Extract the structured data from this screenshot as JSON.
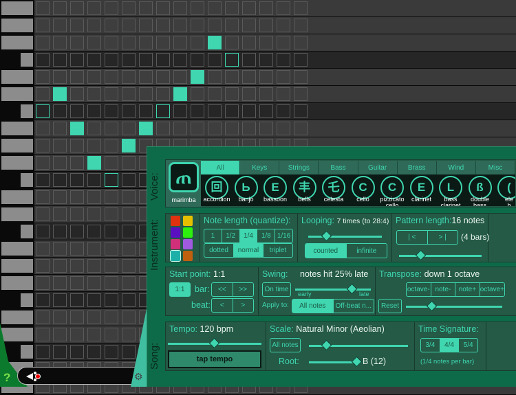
{
  "sequencer": {
    "rows": 23,
    "columns": 16,
    "black_key_rows": [
      3,
      6,
      10,
      13,
      17,
      20
    ],
    "active_cells": [
      [
        2,
        10
      ],
      [
        3,
        11
      ],
      [
        4,
        9
      ],
      [
        5,
        1
      ],
      [
        5,
        8
      ],
      [
        6,
        0
      ],
      [
        6,
        7
      ],
      [
        7,
        2
      ],
      [
        7,
        6
      ],
      [
        8,
        5
      ],
      [
        9,
        3
      ],
      [
        10,
        4
      ]
    ],
    "accent_color": "#3fd6b0"
  },
  "toolbar": {
    "help_label": "?",
    "play_icon": "trumpet-record-icon",
    "settings_icon": "gear-icon"
  },
  "panel": {
    "voice_section_label": "Voice:",
    "instrument_section_label": "Instrument:",
    "song_section_label": "Song:",
    "current_voice": {
      "name": "marimba",
      "glyph": "ጠ"
    },
    "categories": [
      {
        "label": "All",
        "selected": true
      },
      {
        "label": "Keys"
      },
      {
        "label": "Strings"
      },
      {
        "label": "Bass"
      },
      {
        "label": "Guitar"
      },
      {
        "label": "Brass"
      },
      {
        "label": "Wind"
      },
      {
        "label": "Misc"
      }
    ],
    "voices": [
      {
        "name": "accordion",
        "glyph": "回"
      },
      {
        "name": "banjo",
        "glyph": "Ь"
      },
      {
        "name": "bassoon",
        "glyph": "Ε"
      },
      {
        "name": "bells",
        "glyph": "丰"
      },
      {
        "name": "celesta",
        "glyph": "乇"
      },
      {
        "name": "cello",
        "glyph": "C"
      },
      {
        "name": "pizzicato\ncello",
        "glyph": "C"
      },
      {
        "name": "clarinet",
        "glyph": "E"
      },
      {
        "name": "bass\nclarinet",
        "glyph": "L"
      },
      {
        "name": "double\nbass",
        "glyph": "ß"
      },
      {
        "name": "ele\nb",
        "glyph": "("
      }
    ],
    "colors": [
      "#e0320f",
      "#e6c000",
      "#5a0fc0",
      "#2ef00f",
      "#d0307a",
      "#a05ae0",
      "#1cb0a8",
      "#c0600f"
    ],
    "selected_color_index": 6,
    "note_length": {
      "label": "Note length (quantize):",
      "values": [
        "1",
        "1/2",
        "1/4",
        "1/8",
        "1/16"
      ],
      "selected": "1/4",
      "modes": [
        "dotted",
        "normal",
        "triplet"
      ],
      "selected_mode": "normal"
    },
    "looping": {
      "label": "Looping:",
      "value": "7 times (to 28:4)",
      "slider": 0.25,
      "modes": [
        "counted",
        "infinite"
      ],
      "selected_mode": "counted"
    },
    "pattern_length": {
      "label": "Pattern length:",
      "value": "16 notes",
      "prev": "| <",
      "next": "> |",
      "bars": "(4 bars)",
      "slider": 0.27
    },
    "start_point": {
      "label": "Start point:",
      "value": "1:1",
      "button": "1:1",
      "bar_label": "bar:",
      "beat_label": "beat:",
      "bar_prev": "<<",
      "bar_next": ">>",
      "beat_prev": "<",
      "beat_next": ">"
    },
    "swing": {
      "label": "Swing:",
      "value": "notes hit 25% late",
      "on_time": "On time",
      "early": "early",
      "late": "late",
      "slider": 0.75,
      "apply_label": "Apply to:",
      "apply_options": [
        "All notes",
        "Off-beat n..."
      ],
      "selected_apply": "All notes"
    },
    "transpose": {
      "label": "Transpose:",
      "value": "down 1 octave",
      "buttons": [
        "octave-",
        "note-",
        "note+",
        "octave+"
      ],
      "reset": "Reset",
      "slider": 0.27
    },
    "tempo": {
      "label": "Tempo:",
      "value": "120 bpm",
      "slider": 0.5,
      "tap": "tap tempo"
    },
    "scale": {
      "label": "Scale:",
      "value": "Natural Minor (Aeolian)",
      "all_notes": "All notes",
      "slider": 0.18,
      "root_label": "Root:",
      "root_value": "B (12)",
      "root_slider": 1.0
    },
    "time_signature": {
      "label": "Time Signature:",
      "options": [
        "3/4",
        "4/4",
        "5/4"
      ],
      "selected": "4/4",
      "note": "(1/4 notes per bar)"
    }
  }
}
